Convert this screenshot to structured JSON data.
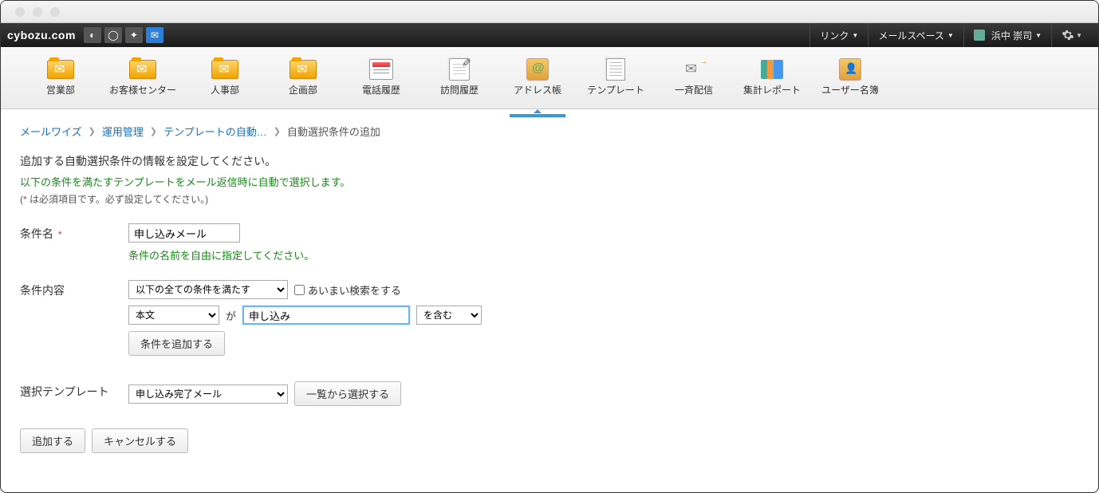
{
  "brand": "cybozu.com",
  "top_menu": {
    "link": "リンク",
    "mailspace": "メールスペース",
    "user": "浜中 崇司"
  },
  "toolbar": [
    {
      "label": "営業部"
    },
    {
      "label": "お客様センター"
    },
    {
      "label": "人事部"
    },
    {
      "label": "企画部"
    },
    {
      "label": "電話履歴"
    },
    {
      "label": "訪問履歴"
    },
    {
      "label": "アドレス帳"
    },
    {
      "label": "テンプレート"
    },
    {
      "label": "一斉配信"
    },
    {
      "label": "集計レポート"
    },
    {
      "label": "ユーザー名簿"
    }
  ],
  "breadcrumb": {
    "items": [
      "メールワイズ",
      "運用管理",
      "テンプレートの自動…"
    ],
    "current": "自動選択条件の追加"
  },
  "desc": {
    "line1": "追加する自動選択条件の情報を設定してください。",
    "line2": "以下の条件を満たすテンプレートをメール返信時に自動で選択します。",
    "line3_a": "(",
    "line3_star": "*",
    "line3_b": " は必須項目です。必ず設定してください。)"
  },
  "form": {
    "name_label": "条件名",
    "name_value": "申し込みメール",
    "name_hint": "条件の名前を自由に指定してください。",
    "cond_label": "条件内容",
    "cond_mode": "以下の全ての条件を満たす",
    "fuzzy_label": "あいまい検索をする",
    "field_sel": "本文",
    "ga": "が",
    "keyword": "申し込み",
    "match_sel": "を含む",
    "add_cond_btn": "条件を追加する",
    "tmpl_label": "選択テンプレート",
    "tmpl_sel": "申し込み完了メール",
    "list_btn": "一覧から選択する"
  },
  "actions": {
    "submit": "追加する",
    "cancel": "キャンセルする"
  }
}
